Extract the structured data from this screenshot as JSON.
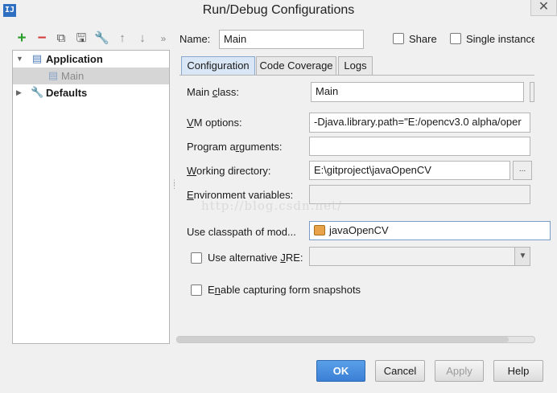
{
  "window": {
    "title": "Run/Debug Configurations",
    "app_icon": "IJ",
    "close_glyph": "✕"
  },
  "toolbar": {
    "add": "+",
    "remove": "−",
    "copy": "⧉",
    "save": "🖫",
    "edit_defaults": "🔧",
    "move_up": "↑",
    "move_down": "↓",
    "more": "»"
  },
  "tree": {
    "items": [
      {
        "label": "Application",
        "expanded": true
      },
      {
        "label": "Main"
      },
      {
        "label": "Defaults",
        "expanded": false
      }
    ]
  },
  "name_row": {
    "name_label": "Name:",
    "name_value": "Main",
    "share_label": "Share",
    "single_instance_label": "Single instance"
  },
  "tabs": [
    "Configuration",
    "Code Coverage",
    "Logs"
  ],
  "form": {
    "main_class_label": "Main class:",
    "main_class_value": "Main",
    "vm_options_label": "VM options:",
    "vm_options_value": "-Djava.library.path=\"E:/opencv3.0 alpha/oper",
    "program_args_label": "Program arguments:",
    "program_args_value": "",
    "working_dir_label": "Working directory:",
    "working_dir_value": "E:\\gitproject\\javaOpenCV",
    "browse_glyph": "...",
    "env_vars_label": "Environment variables:",
    "env_vars_value": "",
    "classpath_label": "Use classpath of mod...",
    "classpath_value": "javaOpenCV",
    "alt_jre_label": "Use alternative JRE:",
    "alt_jre_value": "",
    "snapshots_label": "Enable capturing form snapshots"
  },
  "watermark": "http://blog.csdn.net/",
  "buttons": {
    "ok": "OK",
    "cancel": "Cancel",
    "apply": "Apply",
    "help": "Help"
  },
  "colors": {
    "accent": "#3a7fd5",
    "active_tab": "#d8e6f5",
    "selection": "#d6d6d6"
  }
}
